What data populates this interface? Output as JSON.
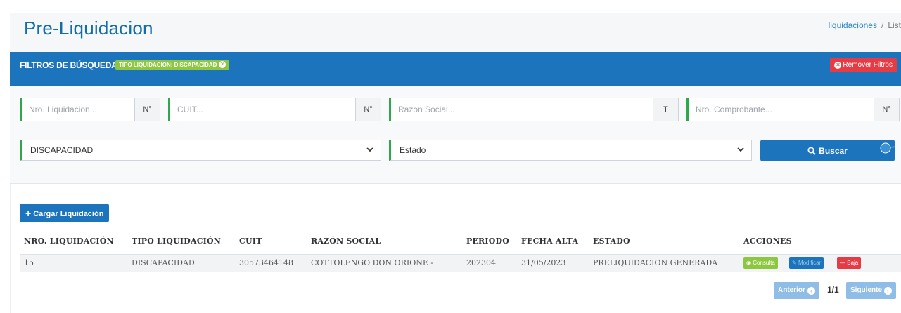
{
  "header": {
    "title": "Pre-Liquidacion",
    "breadcrumb": {
      "parent": "liquidaciones",
      "separator": "/",
      "current": "List"
    }
  },
  "filters": {
    "title": "FILTROS DE BÚSQUEDA",
    "active_chip": "TIPO LIQUIDACION: DISCAPACIDAD",
    "remove_label": "Remover Filtros",
    "inputs": [
      {
        "placeholder": "Nro. Liquidacion...",
        "addon": "N°"
      },
      {
        "placeholder": "CUIT...",
        "addon": "N°"
      },
      {
        "placeholder": "Razon Social...",
        "addon": "T"
      },
      {
        "placeholder": "Nro. Comprobante...",
        "addon": "N°"
      }
    ],
    "tipo_select": {
      "value": "DISCAPACIDAD"
    },
    "estado_select": {
      "value": "Estado"
    },
    "search_label": "Buscar"
  },
  "results": {
    "add_label": "Cargar Liquidación",
    "columns": [
      "NRO. LIQUIDACIÓN",
      "TIPO LIQUIDACIÓN",
      "CUIT",
      "RAZÓN SOCIAL",
      "PERIODO",
      "FECHA ALTA",
      "ESTADO",
      "ACCIONES"
    ],
    "rows": [
      {
        "nro": "15",
        "tipo": "DISCAPACIDAD",
        "cuit": "30573464148",
        "razon_social": "COTTOLENGO DON ORIONE -",
        "periodo": "202304",
        "fecha_alta": "31/05/2023",
        "estado": "PRELIQUIDACION GENERADA",
        "actions": {
          "consulta": "Consulta",
          "modificar": "Modificar",
          "baja": "Baja"
        }
      }
    ]
  },
  "pagination": {
    "prev_label": "Anterior",
    "info": "1/1",
    "next_label": "Siguiente"
  },
  "colors": {
    "primary": "#1c75bc",
    "success": "#8dc63f",
    "danger": "#e43b45",
    "input_accent": "#2ea84a"
  }
}
